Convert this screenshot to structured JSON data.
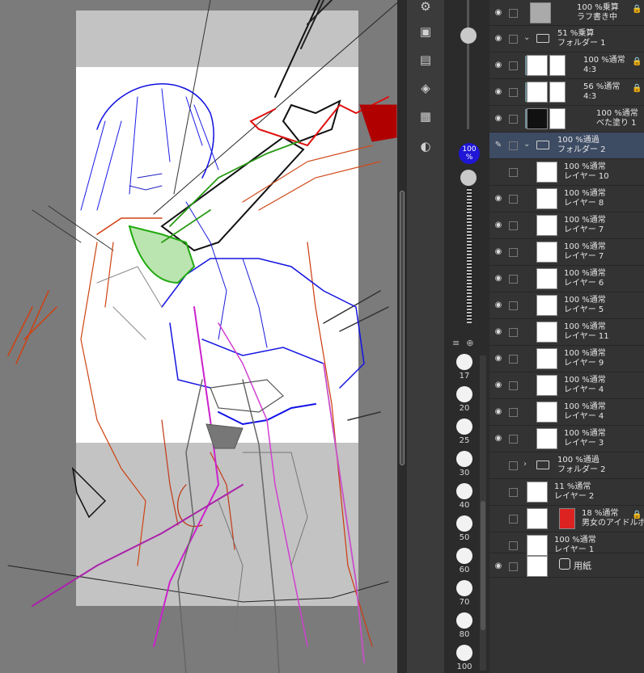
{
  "canvas": {
    "sketch": "line-art-drawing"
  },
  "tools": [
    {
      "icon": "layer-search-icon"
    },
    {
      "icon": "animation-timeline-icon"
    },
    {
      "icon": "navigator-icon"
    },
    {
      "icon": "layer-stack-icon"
    },
    {
      "icon": "film-icon"
    },
    {
      "icon": "image-material-icon"
    }
  ],
  "opacity_slider": {
    "badge": "100\n%",
    "value": 1.0
  },
  "brush_sizes": [
    "17",
    "20",
    "25",
    "30",
    "40",
    "50",
    "60",
    "70",
    "80",
    "100"
  ],
  "layers": [
    {
      "mode": "100 %乗算",
      "name": "ラフ書き中",
      "type": "layer"
    },
    {
      "mode": "51 %乗算",
      "name": "フォルダー 1",
      "type": "folder",
      "open": true
    },
    {
      "mode": "100 %通常",
      "name": "4:3",
      "type": "layer"
    },
    {
      "mode": "56 %通常",
      "name": "4:3",
      "type": "layer"
    },
    {
      "mode": "100 %通常",
      "name": "べた塗り 1",
      "type": "layer"
    },
    {
      "mode": "100 %通過",
      "name": "フォルダー 2",
      "type": "folder",
      "open": true,
      "active": true
    },
    {
      "mode": "100 %通常",
      "name": "レイヤー 10",
      "type": "layer"
    },
    {
      "mode": "100 %通常",
      "name": "レイヤー 8",
      "type": "layer"
    },
    {
      "mode": "100 %通常",
      "name": "レイヤー 7",
      "type": "layer"
    },
    {
      "mode": "100 %通常",
      "name": "レイヤー 7",
      "type": "layer"
    },
    {
      "mode": "100 %通常",
      "name": "レイヤー 6",
      "type": "layer"
    },
    {
      "mode": "100 %通常",
      "name": "レイヤー 5",
      "type": "layer"
    },
    {
      "mode": "100 %通常",
      "name": "レイヤー 11",
      "type": "layer"
    },
    {
      "mode": "100 %通常",
      "name": "レイヤー 9",
      "type": "layer"
    },
    {
      "mode": "100 %通常",
      "name": "レイヤー 4",
      "type": "layer"
    },
    {
      "mode": "100 %通常",
      "name": "レイヤー 4",
      "type": "layer"
    },
    {
      "mode": "100 %通常",
      "name": "レイヤー 3",
      "type": "layer"
    },
    {
      "mode": "100 %通過",
      "name": "フォルダー 2",
      "type": "folder",
      "open": false
    },
    {
      "mode": "11 %通常",
      "name": "レイヤー 2",
      "type": "layer"
    },
    {
      "mode": "18 %通常",
      "name": "男女のアイドルポーズ",
      "type": "layer"
    },
    {
      "mode": "100 %通常",
      "name": "レイヤー 1",
      "type": "layer"
    },
    {
      "mode": "",
      "name": "用紙",
      "type": "paper"
    }
  ]
}
